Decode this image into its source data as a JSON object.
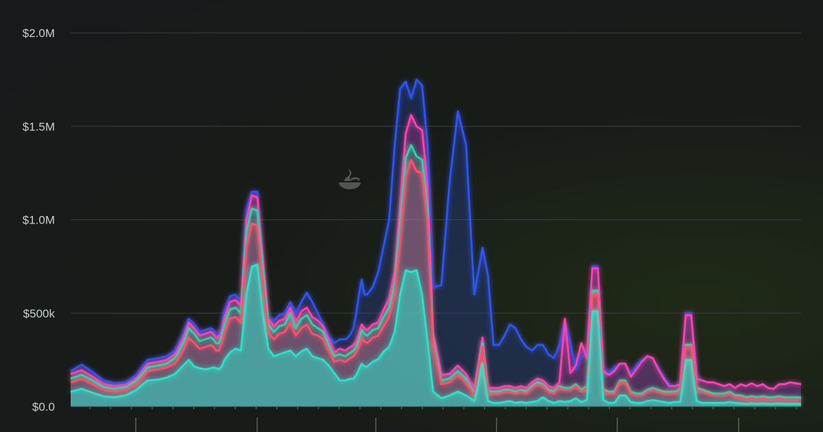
{
  "chart_data": {
    "type": "area",
    "title": "",
    "xlabel": "",
    "ylabel": "",
    "ylim": [
      0,
      2000000
    ],
    "yticks": [
      0,
      500000,
      1000000,
      1500000,
      2000000
    ],
    "ytick_labels": [
      "$0.0",
      "$500k",
      "$1.0M",
      "$1.5M",
      "$2.0M"
    ],
    "grid": true,
    "x": [
      0,
      4,
      8,
      12,
      16,
      20,
      24,
      28,
      32,
      35,
      38,
      41,
      43,
      45,
      47,
      49,
      51,
      52,
      53,
      54,
      55,
      56,
      58,
      60,
      62,
      64,
      66,
      68,
      70,
      72,
      74,
      76,
      78,
      80,
      82,
      84,
      86,
      88,
      90,
      92,
      94,
      96,
      98,
      100,
      101,
      102,
      103,
      104,
      105,
      106,
      107,
      108,
      110,
      112,
      114,
      116,
      118,
      120,
      122,
      124,
      126,
      128,
      130,
      132,
      135,
      138,
      141,
      144,
      147,
      150,
      152,
      154,
      156,
      158,
      160,
      162,
      164,
      166,
      168,
      170,
      172,
      174,
      176,
      178,
      180,
      182,
      184,
      186,
      188,
      190,
      192,
      194,
      196,
      198,
      200,
      202,
      204,
      206,
      208,
      210,
      212,
      214,
      216,
      218,
      220,
      222,
      224,
      226,
      228,
      230,
      232,
      234,
      236,
      238,
      240,
      242,
      244,
      246,
      248,
      250,
      252,
      254,
      256,
      258,
      260,
      262,
      264,
      266
    ],
    "series": [
      {
        "color": "#2de0c8",
        "values": [
          80000,
          95000,
          75000,
          55000,
          50000,
          60000,
          90000,
          140000,
          145000,
          155000,
          175000,
          220000,
          250000,
          215000,
          205000,
          200000,
          205000,
          210000,
          205000,
          200000,
          215000,
          250000,
          290000,
          310000,
          300000,
          600000,
          750000,
          760000,
          500000,
          310000,
          270000,
          280000,
          290000,
          300000,
          270000,
          295000,
          310000,
          270000,
          260000,
          250000,
          220000,
          180000,
          140000,
          140000,
          145000,
          150000,
          150000,
          170000,
          200000,
          230000,
          215000,
          215000,
          240000,
          255000,
          295000,
          320000,
          400000,
          600000,
          730000,
          720000,
          730000,
          600000,
          350000,
          80000,
          45000,
          60000,
          80000,
          60000,
          30000,
          230000,
          30000,
          20000,
          20000,
          25000,
          30000,
          20000,
          25000,
          20000,
          25000,
          30000,
          50000,
          30000,
          20000,
          30000,
          25000,
          30000,
          45000,
          25000,
          35000,
          510000,
          510000,
          35000,
          20000,
          20000,
          60000,
          60000,
          25000,
          20000,
          20000,
          30000,
          35000,
          30000,
          25000,
          20000,
          25000,
          25000,
          250000,
          250000,
          30000,
          20000,
          20000,
          20000,
          20000,
          20000,
          25000,
          20000,
          18000,
          15000,
          18000,
          15000,
          18000,
          15000,
          15000,
          18000,
          15000,
          15000,
          15000,
          15000
        ]
      },
      {
        "color": "#ff4f6a",
        "values": [
          130000,
          150000,
          120000,
          90000,
          80000,
          90000,
          120000,
          190000,
          200000,
          210000,
          230000,
          300000,
          370000,
          340000,
          310000,
          320000,
          330000,
          320000,
          300000,
          300000,
          340000,
          400000,
          470000,
          480000,
          450000,
          860000,
          980000,
          970000,
          680000,
          400000,
          360000,
          390000,
          400000,
          450000,
          380000,
          420000,
          440000,
          390000,
          380000,
          360000,
          300000,
          240000,
          250000,
          240000,
          250000,
          260000,
          270000,
          290000,
          320000,
          370000,
          350000,
          340000,
          370000,
          380000,
          430000,
          480000,
          600000,
          900000,
          1230000,
          1320000,
          1260000,
          1250000,
          1000000,
          330000,
          120000,
          130000,
          170000,
          130000,
          60000,
          320000,
          70000,
          70000,
          70000,
          80000,
          80000,
          70000,
          80000,
          70000,
          100000,
          120000,
          110000,
          80000,
          70000,
          100000,
          90000,
          90000,
          110000,
          80000,
          100000,
          600000,
          600000,
          80000,
          70000,
          70000,
          130000,
          130000,
          70000,
          60000,
          60000,
          80000,
          90000,
          80000,
          70000,
          70000,
          70000,
          80000,
          320000,
          320000,
          90000,
          80000,
          70000,
          60000,
          60000,
          60000,
          70000,
          50000,
          50000,
          40000,
          45000,
          40000,
          45000,
          40000,
          40000,
          45000,
          40000,
          40000,
          40000,
          40000
        ]
      },
      {
        "color": "#2bd4a8",
        "values": [
          150000,
          170000,
          140000,
          105000,
          95000,
          105000,
          140000,
          210000,
          220000,
          230000,
          260000,
          340000,
          420000,
          390000,
          350000,
          360000,
          370000,
          360000,
          340000,
          340000,
          380000,
          440000,
          520000,
          530000,
          500000,
          940000,
          1060000,
          1050000,
          740000,
          440000,
          400000,
          430000,
          440000,
          500000,
          420000,
          470000,
          490000,
          440000,
          420000,
          400000,
          330000,
          270000,
          280000,
          270000,
          280000,
          290000,
          300000,
          320000,
          360000,
          410000,
          390000,
          380000,
          410000,
          420000,
          480000,
          530000,
          660000,
          990000,
          1330000,
          1400000,
          1340000,
          1320000,
          1060000,
          360000,
          140000,
          150000,
          190000,
          150000,
          70000,
          340000,
          80000,
          80000,
          80000,
          90000,
          90000,
          80000,
          90000,
          80000,
          110000,
          130000,
          120000,
          90000,
          80000,
          110000,
          100000,
          100000,
          120000,
          90000,
          110000,
          620000,
          620000,
          90000,
          80000,
          80000,
          140000,
          140000,
          80000,
          70000,
          70000,
          90000,
          100000,
          90000,
          80000,
          80000,
          80000,
          90000,
          330000,
          330000,
          100000,
          90000,
          80000,
          70000,
          70000,
          70000,
          80000,
          60000,
          60000,
          50000,
          55000,
          50000,
          55000,
          50000,
          50000,
          55000,
          50000,
          50000,
          50000,
          50000
        ]
      },
      {
        "color": "#ff3fb0",
        "values": [
          175000,
          195000,
          160000,
          120000,
          110000,
          115000,
          150000,
          230000,
          240000,
          250000,
          280000,
          370000,
          450000,
          420000,
          380000,
          390000,
          400000,
          390000,
          370000,
          370000,
          410000,
          480000,
          560000,
          570000,
          540000,
          1000000,
          1130000,
          1120000,
          790000,
          470000,
          430000,
          460000,
          470000,
          530000,
          450000,
          510000,
          530000,
          480000,
          460000,
          430000,
          360000,
          290000,
          310000,
          300000,
          310000,
          320000,
          330000,
          350000,
          390000,
          440000,
          420000,
          410000,
          440000,
          450000,
          520000,
          580000,
          720000,
          1080000,
          1460000,
          1560000,
          1500000,
          1480000,
          1180000,
          400000,
          170000,
          175000,
          220000,
          175000,
          90000,
          370000,
          100000,
          100000,
          100000,
          110000,
          110000,
          100000,
          110000,
          100000,
          130000,
          150000,
          140000,
          110000,
          100000,
          130000,
          470000,
          180000,
          220000,
          340000,
          260000,
          740000,
          740000,
          190000,
          170000,
          190000,
          230000,
          230000,
          160000,
          200000,
          240000,
          270000,
          260000,
          200000,
          150000,
          110000,
          110000,
          120000,
          490000,
          490000,
          150000,
          140000,
          130000,
          130000,
          120000,
          110000,
          120000,
          100000,
          120000,
          110000,
          125000,
          110000,
          120000,
          100000,
          95000,
          120000,
          120000,
          130000,
          125000,
          120000
        ]
      },
      {
        "color": "#2f55f0",
        "values": [
          190000,
          225000,
          185000,
          140000,
          125000,
          130000,
          170000,
          250000,
          260000,
          270000,
          300000,
          390000,
          470000,
          440000,
          400000,
          410000,
          420000,
          410000,
          390000,
          390000,
          430000,
          510000,
          590000,
          600000,
          560000,
          1050000,
          1150000,
          1150000,
          800000,
          480000,
          460000,
          490000,
          500000,
          560000,
          500000,
          560000,
          610000,
          560000,
          500000,
          440000,
          380000,
          340000,
          360000,
          360000,
          370000,
          390000,
          420000,
          500000,
          600000,
          680000,
          600000,
          600000,
          640000,
          720000,
          860000,
          1000000,
          1400000,
          1700000,
          1740000,
          1650000,
          1750000,
          1720000,
          1400000,
          640000,
          650000,
          1200000,
          1580000,
          1400000,
          600000,
          850000,
          700000,
          330000,
          330000,
          380000,
          440000,
          420000,
          360000,
          320000,
          300000,
          330000,
          330000,
          280000,
          260000,
          330000,
          460000,
          340000,
          200000,
          280000,
          290000,
          750000,
          750000,
          210000,
          180000,
          210000,
          230000,
          230000,
          170000,
          220000,
          250000,
          270000,
          260000,
          210000,
          160000,
          120000,
          110000,
          130000,
          500000,
          500000,
          160000,
          140000,
          130000,
          130000,
          120000,
          110000,
          120000,
          100000,
          120000,
          110000,
          125000,
          110000,
          120000,
          100000,
          95000,
          120000,
          120000,
          130000,
          125000,
          120000
        ]
      }
    ]
  }
}
